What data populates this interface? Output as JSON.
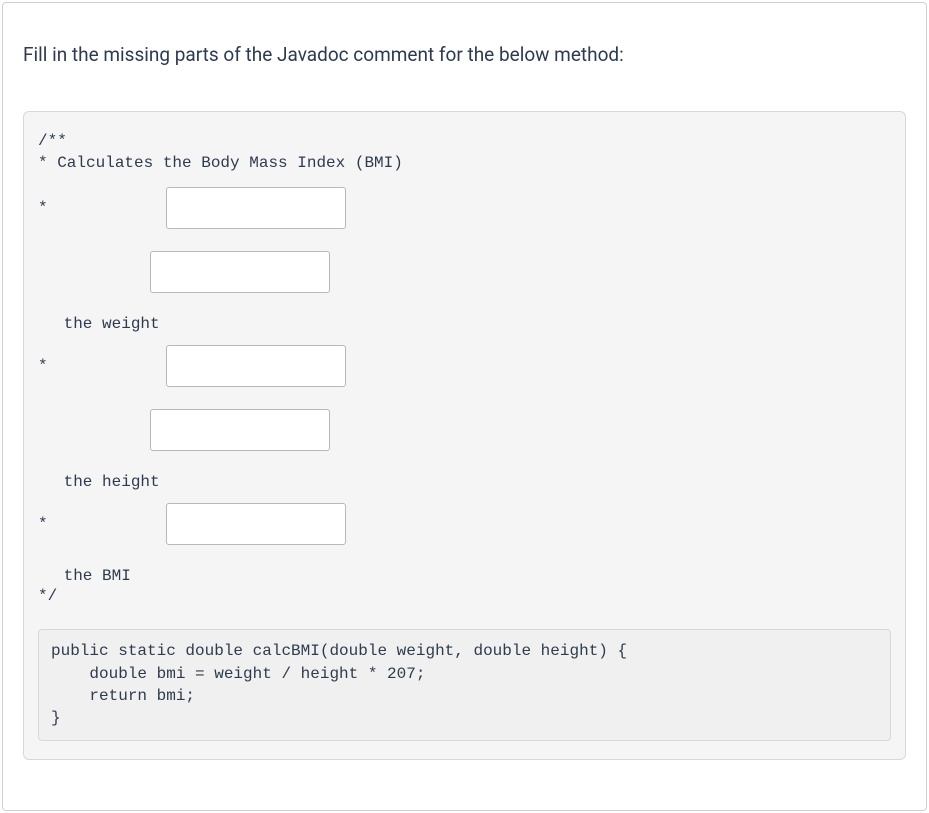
{
  "question": {
    "title": "Fill in the missing parts of the Javadoc comment for the below method:"
  },
  "javadoc": {
    "open": "/**",
    "desc": "* Calculates the Body Mass Index (BMI)",
    "star": "*",
    "weight_label": " the weight",
    "height_label": " the height",
    "bmi_label": " the BMI",
    "close": "*/"
  },
  "inputs": {
    "blank1": "",
    "blank2": "",
    "blank3": "",
    "blank4": "",
    "blank5": ""
  },
  "method": {
    "line1": "public static double calcBMI(double weight, double height) {",
    "line2": "    double bmi = weight / height * 207;",
    "line3": "    return bmi;",
    "line4": "}"
  }
}
